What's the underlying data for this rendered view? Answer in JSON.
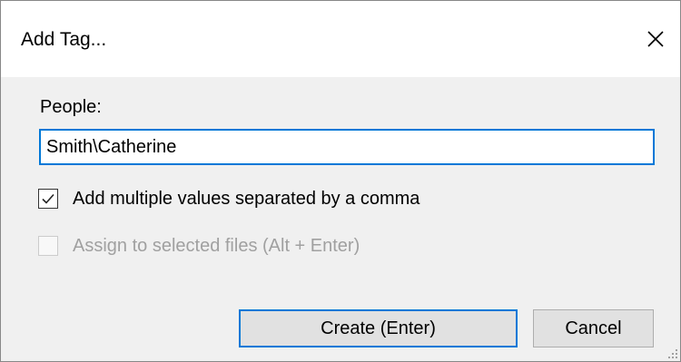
{
  "dialog": {
    "title": "Add Tag...",
    "close_icon": "close-icon"
  },
  "people": {
    "label": "People:",
    "value": "Smith\\Catherine"
  },
  "options": {
    "multiple_values": {
      "label": "Add multiple values separated by a comma",
      "checked": true,
      "enabled": true
    },
    "assign_selected": {
      "label": "Assign to selected files (Alt + Enter)",
      "checked": false,
      "enabled": false
    }
  },
  "buttons": {
    "create_label": "Create (Enter)",
    "cancel_label": "Cancel"
  },
  "colors": {
    "accent": "#0078d7",
    "disabled_text": "#a0a0a0",
    "dialog_bg": "#f0f0f0"
  }
}
